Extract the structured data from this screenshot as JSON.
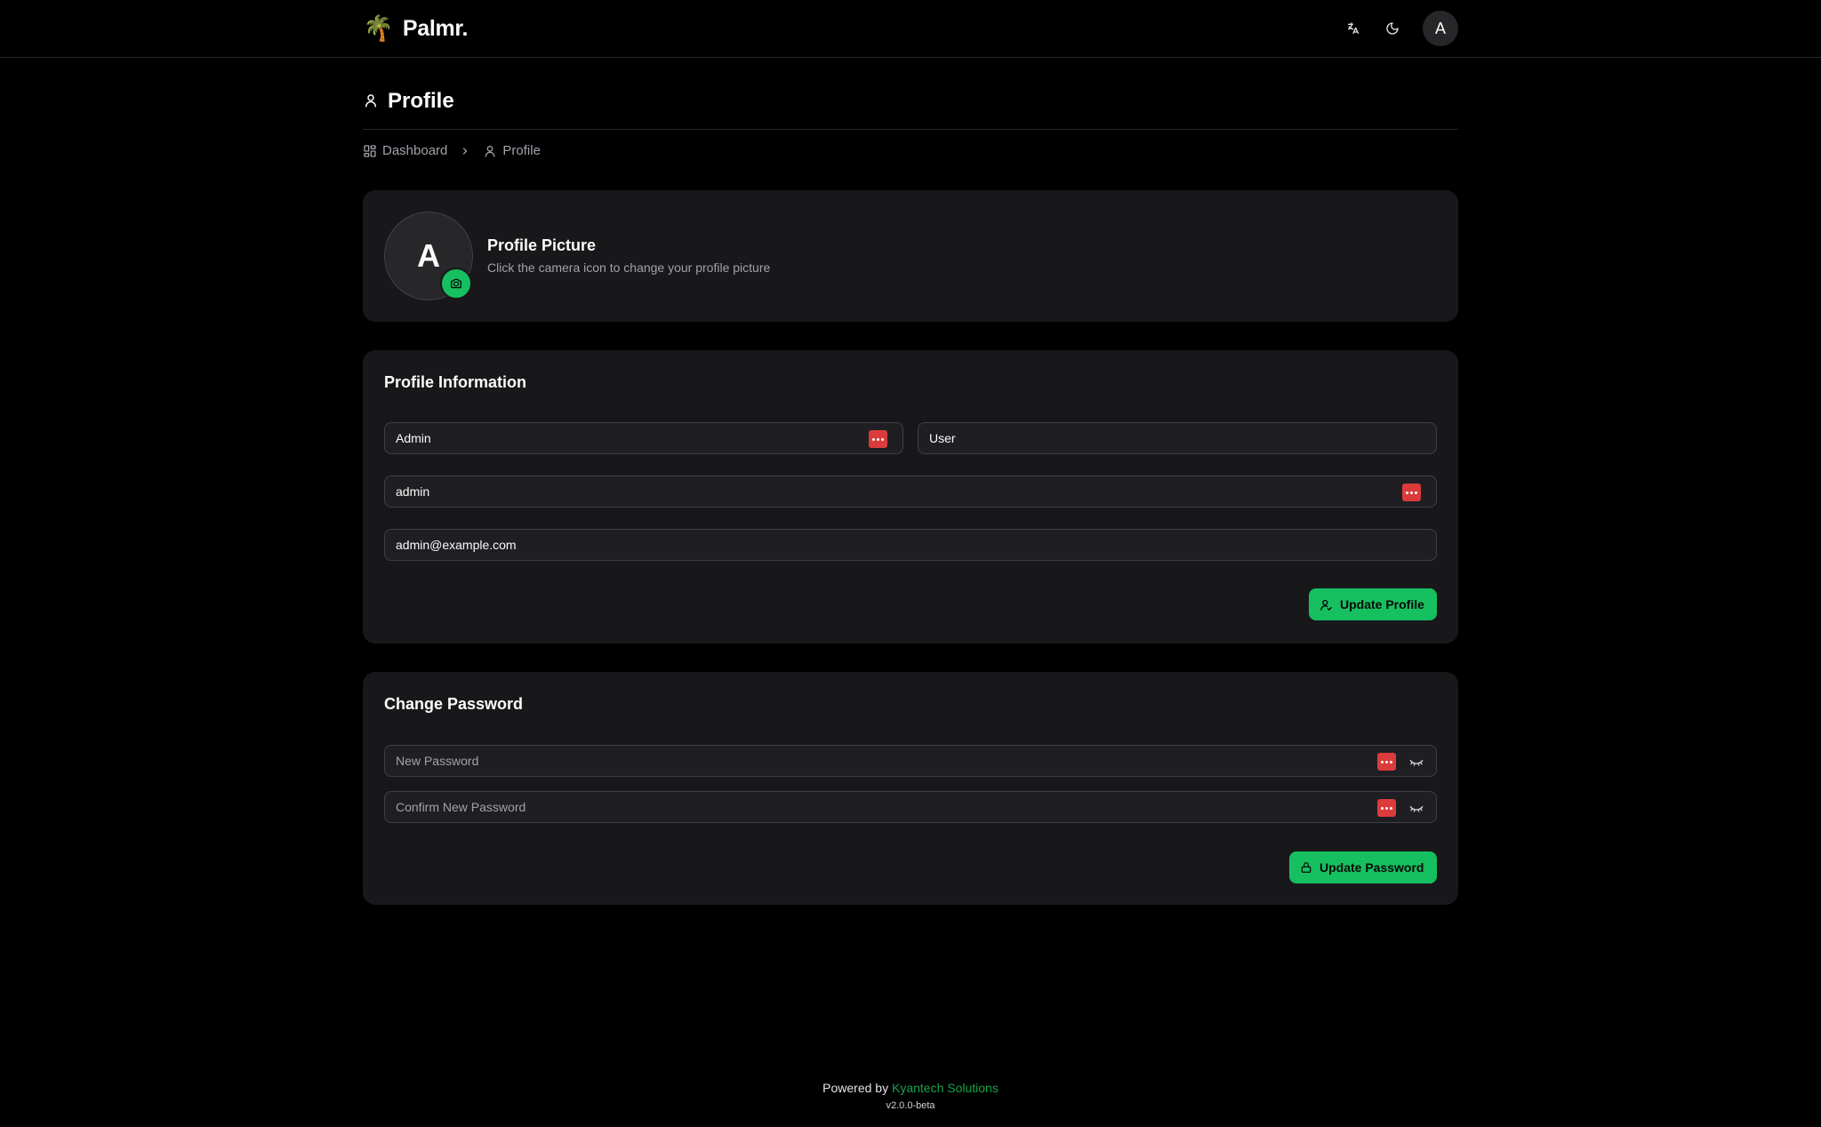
{
  "header": {
    "brand_logo": "🌴",
    "brand_name": "Palmr.",
    "avatar_initial": "A",
    "icons": [
      "translate-icon",
      "moon-icon"
    ]
  },
  "page": {
    "title": "Profile"
  },
  "breadcrumb": {
    "items": [
      {
        "label": "Dashboard",
        "icon": "dashboard-icon"
      },
      {
        "label": "Profile",
        "icon": "user-icon"
      }
    ]
  },
  "profile_picture": {
    "initial": "A",
    "title": "Profile Picture",
    "subtitle": "Click the camera icon to change your profile picture"
  },
  "profile_info": {
    "title": "Profile Information",
    "first_name": "Admin",
    "last_name": "User",
    "username": "admin",
    "email": "admin@example.com",
    "update_label": "Update Profile"
  },
  "change_password": {
    "title": "Change Password",
    "new_placeholder": "New Password",
    "confirm_placeholder": "Confirm New Password",
    "update_label": "Update Password"
  },
  "footer": {
    "powered_prefix": "Powered by",
    "company": "Kyantech Solutions",
    "version": "v2.0.0-beta"
  },
  "colors": {
    "background": "#000000",
    "card": "#18181b",
    "accent": "#16c060",
    "password_manager_badge": "#dc3b3b"
  }
}
